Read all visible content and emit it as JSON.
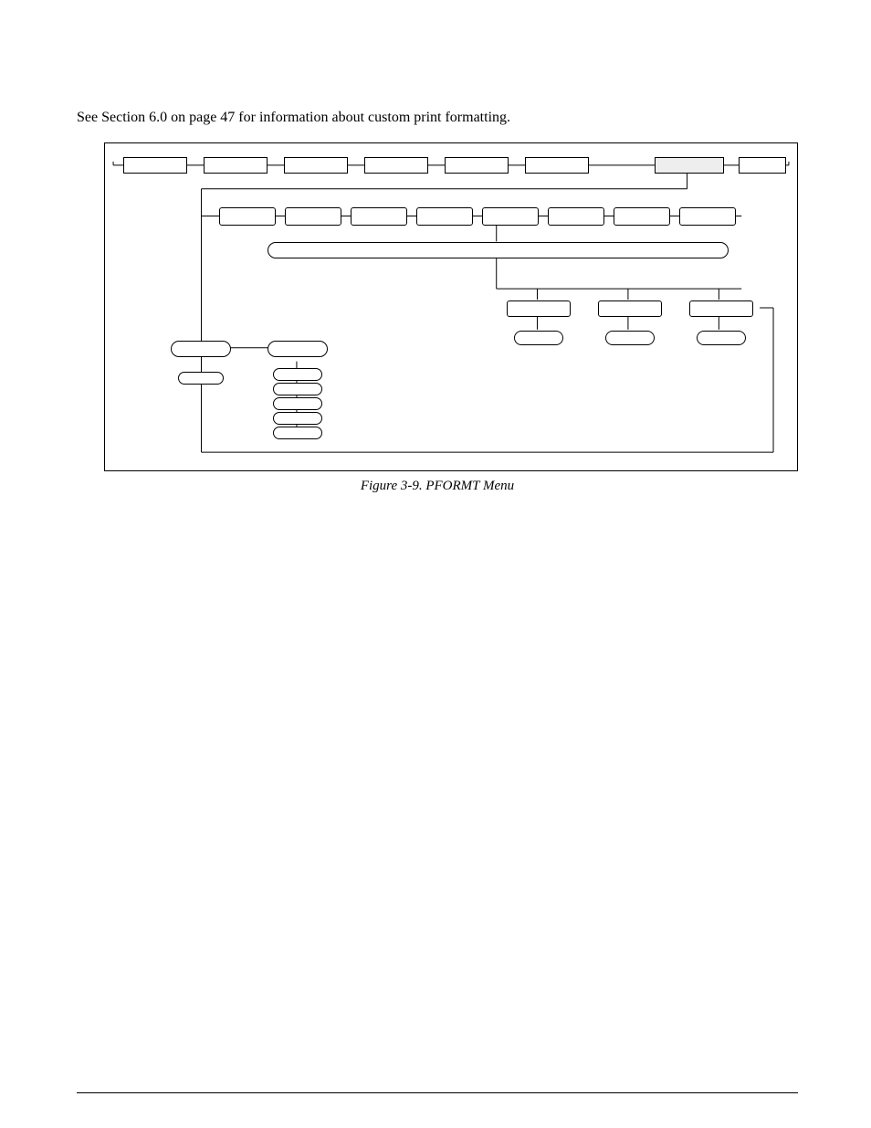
{
  "intro_text": "See Section 6.0 on page 47 for information about custom print formatting.",
  "caption": "Figure 3-9. PFORMT Menu"
}
